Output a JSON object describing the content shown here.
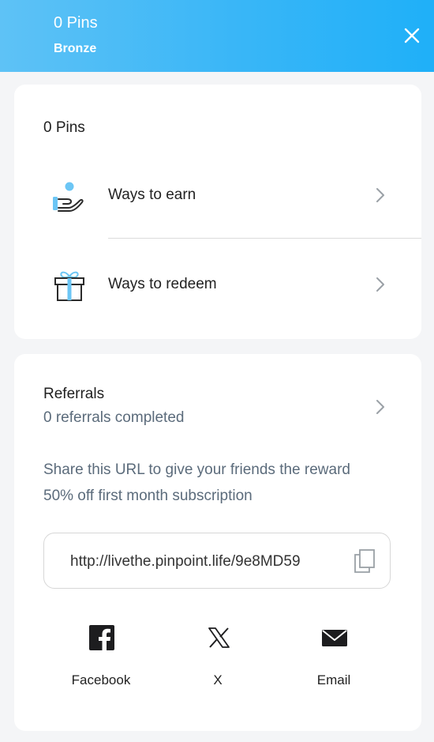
{
  "header": {
    "points": "0 Pins",
    "tier": "Bronze",
    "close_icon": "close-icon"
  },
  "rewards": {
    "points": "0 Pins",
    "items": [
      {
        "label": "Ways to earn",
        "icon": "hand-coin-icon"
      },
      {
        "label": "Ways to redeem",
        "icon": "gift-icon"
      }
    ]
  },
  "referrals": {
    "title": "Referrals",
    "count": "0 referrals completed",
    "description": "Share this URL to give your friends the reward 50% off first month subscription",
    "url": "http://livethe.pinpoint.life/9e8MD59",
    "share": [
      {
        "label": "Facebook",
        "icon": "facebook-icon"
      },
      {
        "label": "X",
        "icon": "x-icon"
      },
      {
        "label": "Email",
        "icon": "email-icon"
      }
    ]
  },
  "colors": {
    "header_gradient_start": "#5ec2f6",
    "header_gradient_end": "#1fb0f8",
    "accent": "#3ab7f4",
    "muted_text": "#5b6b7b"
  }
}
